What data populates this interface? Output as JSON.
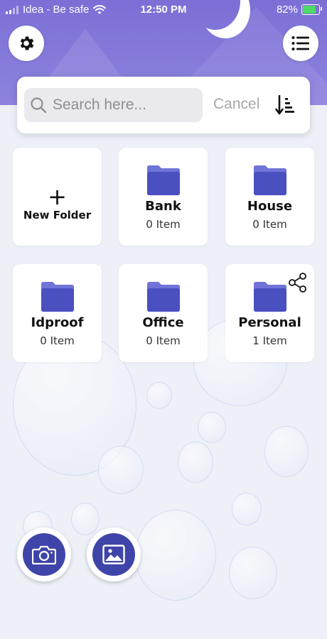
{
  "status_bar": {
    "carrier": "Idea - Be safe",
    "time": "12:50 PM",
    "battery": "82%"
  },
  "search": {
    "placeholder": "Search here...",
    "cancel_label": "Cancel"
  },
  "new_folder": {
    "label": "New Folder"
  },
  "folders": [
    {
      "name": "Bank",
      "count": "0 Item"
    },
    {
      "name": "House",
      "count": "0 Item"
    },
    {
      "name": "Idproof",
      "count": "0 Item"
    },
    {
      "name": "Office",
      "count": "0 Item"
    },
    {
      "name": "Personal",
      "count": "1 Item",
      "shared": true
    }
  ],
  "colors": {
    "header": "#7b6fd6",
    "folder": "#4a50c0",
    "folder_tab": "#6f74d8",
    "fab": "#3f45a8",
    "background": "#eef0f8"
  },
  "icons": [
    "gear-icon",
    "menu-list-icon",
    "search-icon",
    "sort-icon",
    "folder-icon",
    "share-icon",
    "camera-icon",
    "gallery-icon"
  ]
}
